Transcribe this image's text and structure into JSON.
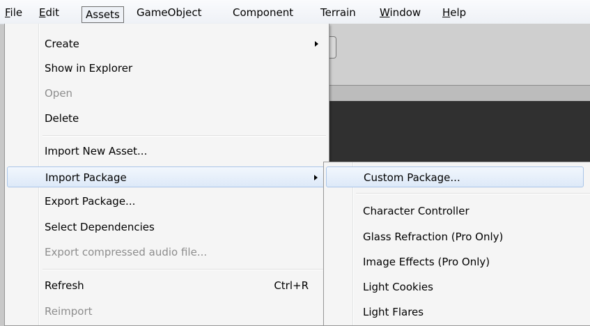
{
  "menubar": {
    "items": [
      {
        "mnemonic": "F",
        "rest": "ile"
      },
      {
        "mnemonic": "E",
        "rest": "dit"
      },
      {
        "label": "Assets"
      },
      {
        "label": "GameObject"
      },
      {
        "label": "Component"
      },
      {
        "label": "Terrain"
      },
      {
        "mnemonic": "W",
        "rest": "indow"
      },
      {
        "mnemonic": "H",
        "rest": "elp"
      }
    ],
    "active": "Assets"
  },
  "assets_menu": {
    "items": [
      {
        "label": "Create",
        "submenu": true
      },
      {
        "label": "Show in Explorer"
      },
      {
        "label": "Open",
        "disabled": true
      },
      {
        "label": "Delete"
      },
      {
        "label": "Import New Asset..."
      },
      {
        "label": "Import Package",
        "submenu": true,
        "highlighted": true
      },
      {
        "label": "Export Package..."
      },
      {
        "label": "Select Dependencies"
      },
      {
        "label": "Export compressed audio file...",
        "disabled": true
      },
      {
        "label": "Refresh",
        "shortcut": "Ctrl+R"
      },
      {
        "label": "Reimport",
        "disabled": true
      }
    ]
  },
  "import_package_submenu": {
    "items": [
      {
        "label": "Custom Package...",
        "highlighted": true
      },
      {
        "label": "Character Controller"
      },
      {
        "label": "Glass Refraction (Pro Only)"
      },
      {
        "label": "Image Effects (Pro Only)"
      },
      {
        "label": "Light Cookies"
      },
      {
        "label": "Light Flares"
      }
    ]
  }
}
